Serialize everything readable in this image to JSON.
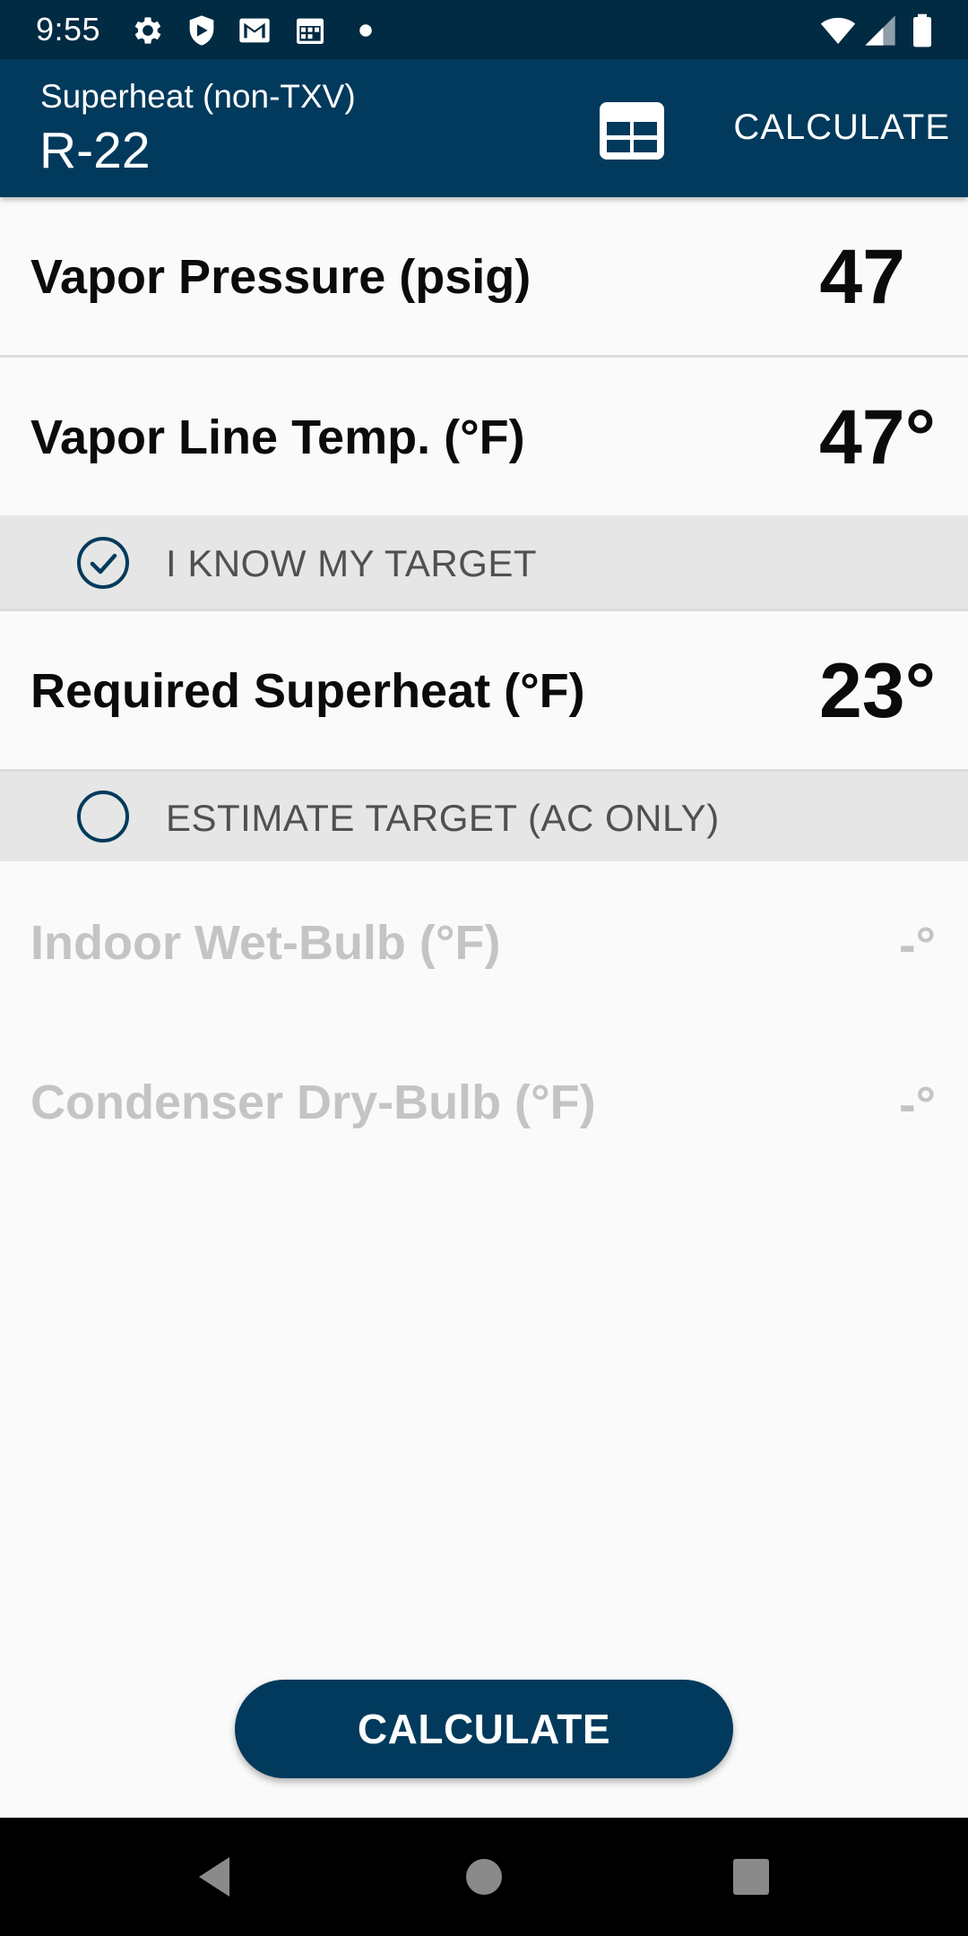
{
  "status_bar": {
    "time": "9:55",
    "icons_left": [
      "gear-icon",
      "shield-icon",
      "gmail-icon",
      "calendar-icon",
      "dot-icon"
    ],
    "icons_right": [
      "wifi-icon",
      "signal-icon",
      "battery-icon"
    ]
  },
  "app_bar": {
    "subtitle": "Superheat (non-TXV)",
    "title": "R-22",
    "table_icon": "table-icon",
    "action_label": "CALCULATE",
    "background_color": "#013a5c"
  },
  "fields": {
    "vapor_pressure": {
      "label": "Vapor Pressure (psig)",
      "value": "47"
    },
    "vapor_line_temp": {
      "label": "Vapor Line Temp. (°F)",
      "value": "47°"
    },
    "required_superheat": {
      "label": "Required Superheat (°F)",
      "value": "23°"
    },
    "indoor_wet_bulb": {
      "label": "Indoor Wet-Bulb (°F)",
      "value": "-°"
    },
    "condenser_dry_bulb": {
      "label": "Condenser Dry-Bulb (°F)",
      "value": "-°"
    }
  },
  "options": {
    "know_target": {
      "label": "I KNOW MY TARGET",
      "selected": true
    },
    "estimate_target": {
      "label": "ESTIMATE TARGET (AC ONLY)",
      "selected": false
    }
  },
  "calculate_button": {
    "label": "CALCULATE"
  },
  "nav_bar": {
    "buttons": [
      "back-icon",
      "home-icon",
      "recents-icon"
    ]
  }
}
